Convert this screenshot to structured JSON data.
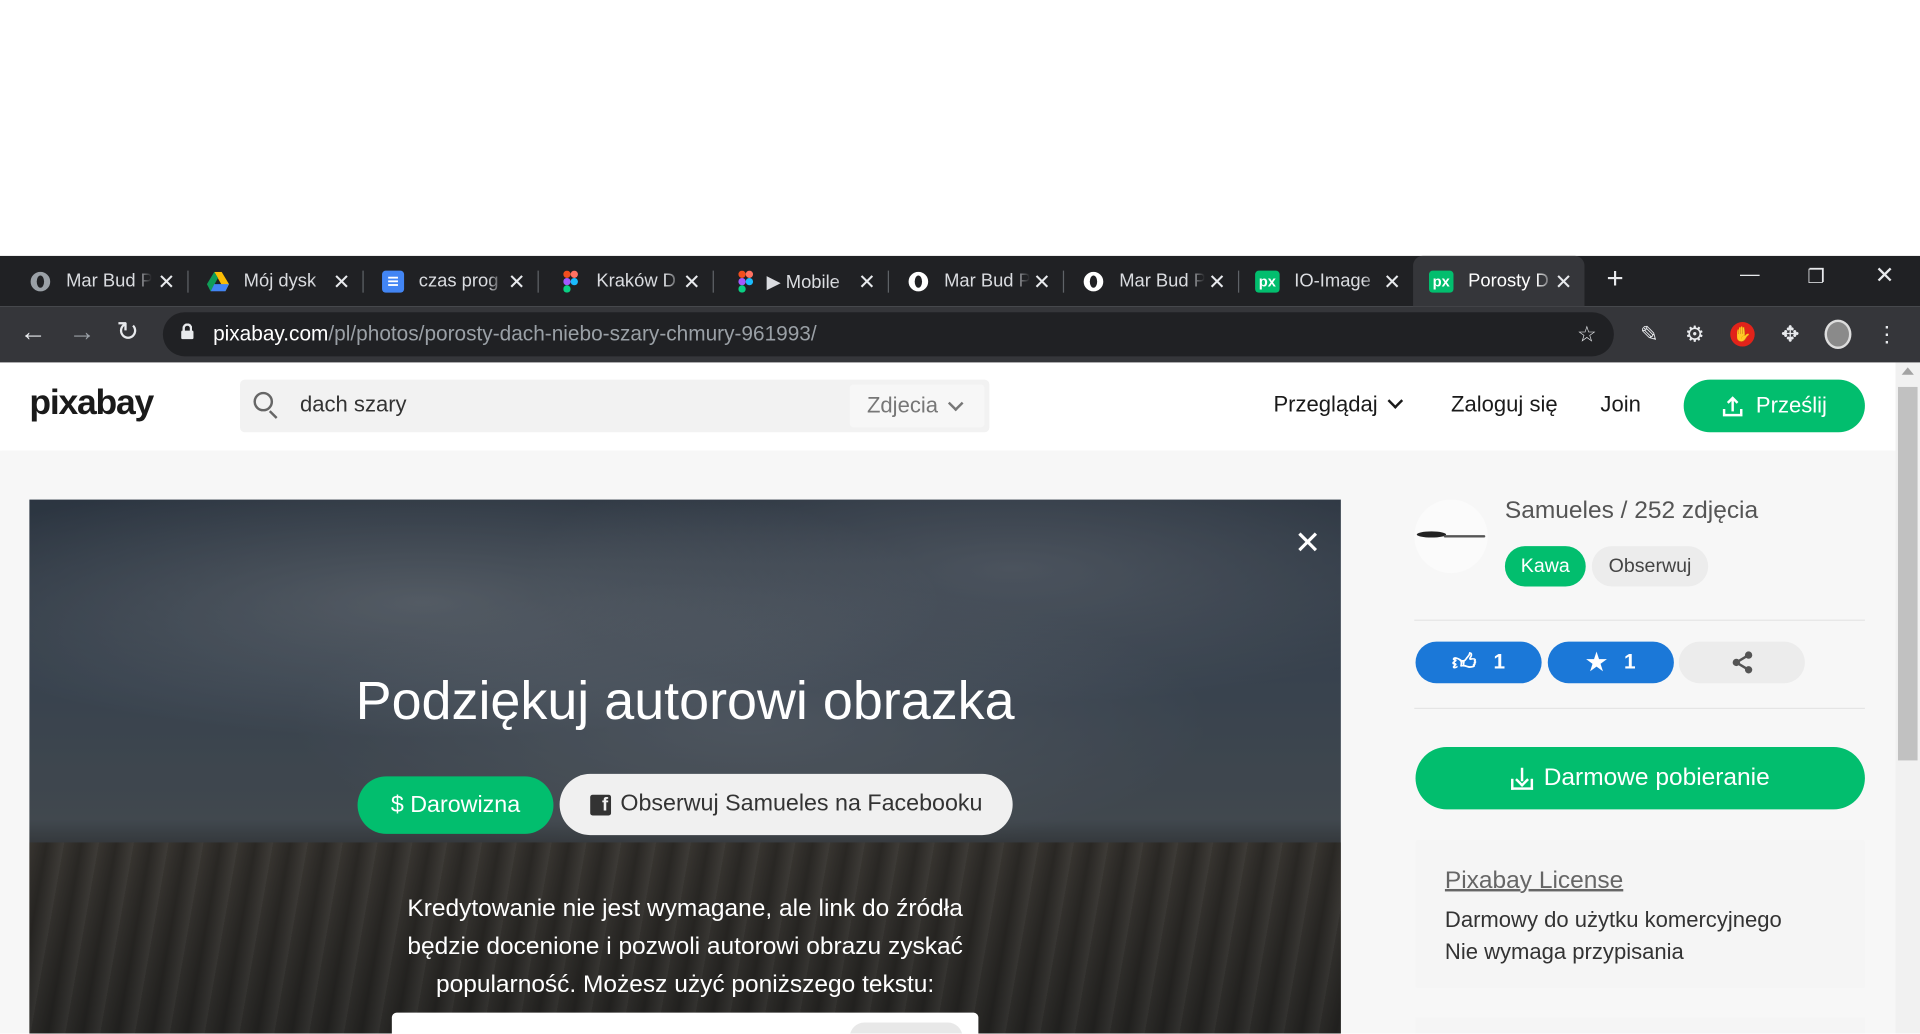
{
  "browser": {
    "tabs": [
      {
        "label": "Mar Bud P",
        "icon": "globe-icon"
      },
      {
        "label": "Mój dysk",
        "icon": "google-drive-icon"
      },
      {
        "label": "czas prog",
        "icon": "google-docs-icon"
      },
      {
        "label": "Kraków D",
        "icon": "figma-icon"
      },
      {
        "label": "▶ Mobile",
        "icon": "figma-icon"
      },
      {
        "label": "Mar Bud P",
        "icon": "globe-icon"
      },
      {
        "label": "Mar Bud P",
        "icon": "globe-icon"
      },
      {
        "label": "IO-Image",
        "icon": "pixabay-icon"
      },
      {
        "label": "Porosty D",
        "icon": "pixabay-icon"
      }
    ],
    "url_host": "pixabay.com",
    "url_path": "/pl/photos/porosty-dach-niebo-szary-chmury-961993/"
  },
  "header": {
    "logo": "pixabay",
    "search_value": "dach szary",
    "search_type": "Zdjecia",
    "browse": "Przeglądaj",
    "login": "Zaloguj się",
    "join": "Join",
    "upload": "Prześlij"
  },
  "modal": {
    "title": "Podziękuj autorowi obrazka",
    "donate": "$ Darowizna",
    "facebook_follow": "Obserwuj Samueles na Facebooku",
    "credit_lines": [
      "Kredytowanie nie jest wymagane, ale link do źródła",
      "będzie docenione i pozwoli autorowi obrazu zyskać",
      "popularność. Możesz użyć poniższego tekstu:"
    ],
    "close": "✕"
  },
  "sidebar": {
    "author": "Samueles / 252 zdjęcia",
    "coffee": "Kawa",
    "follow": "Obserwuj",
    "likes": "1",
    "favorites": "1",
    "download": "Darmowe pobieranie",
    "license_title": "Pixabay License",
    "license_line1": "Darmowy do użytku komercyjnego",
    "license_line2": "Nie wymaga przypisania"
  },
  "colors": {
    "brand_green": "#02be6e",
    "like_blue": "#1b78d8",
    "chrome_dark": "#202124"
  }
}
